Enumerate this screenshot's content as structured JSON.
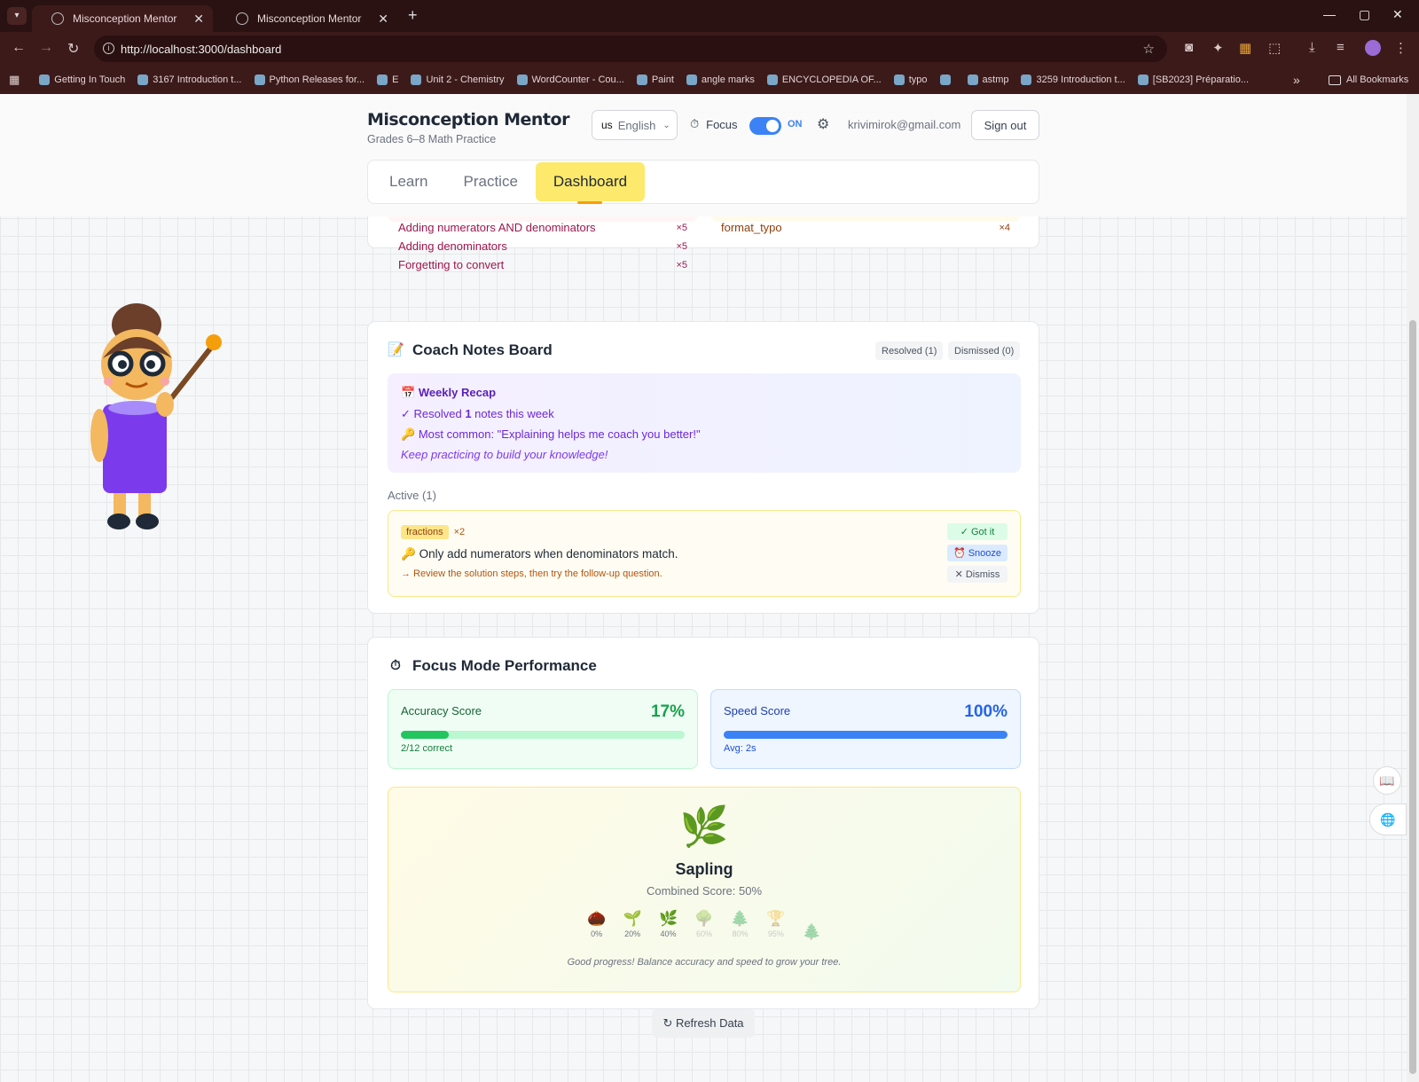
{
  "browser": {
    "tabs": [
      {
        "title": "Misconception Mentor",
        "active": true
      },
      {
        "title": "Misconception Mentor",
        "active": false
      }
    ],
    "url": "http://localhost:3000/dashboard",
    "bookmarks": [
      "Getting In Touch",
      "3167 Introduction t...",
      "Python Releases for...",
      "E",
      "Unit 2 - Chemistry",
      "WordCounter - Cou...",
      "Paint",
      "angle marks",
      "ENCYCLOPEDIA OF...",
      "typo",
      "",
      "astmp",
      "3259 Introduction t...",
      "[SB2023] Préparatio..."
    ],
    "all_bookmarks": "All Bookmarks",
    "more": "»"
  },
  "header": {
    "title": "Misconception Mentor",
    "subtitle": "Grades 6–8 Math Practice",
    "lang_code": "us",
    "lang_label": "English",
    "focus_label": "Focus",
    "focus_state": "ON",
    "email": "krivimirok@gmail.com",
    "signout": "Sign out"
  },
  "nav": {
    "tabs": [
      "Learn",
      "Practice",
      "Dashboard"
    ],
    "active": "Dashboard"
  },
  "misconceptions": {
    "left": [
      {
        "label": "Adding numerators AND denominators",
        "count": "×5"
      },
      {
        "label": "Adding denominators",
        "count": "×5"
      },
      {
        "label": "Forgetting to convert",
        "count": "×5"
      }
    ],
    "right": [
      {
        "label": "format_typo",
        "count": "×4"
      }
    ]
  },
  "coach": {
    "title": "Coach Notes Board",
    "resolved": "Resolved (1)",
    "dismissed": "Dismissed (0)",
    "recap_title": "Weekly Recap",
    "recap_resolved_pre": "✓ Resolved ",
    "recap_resolved_num": "1",
    "recap_resolved_post": " notes this week",
    "recap_common": "Most common: \"Explaining helps me coach you better!\"",
    "recap_keep": "Keep practicing to build your knowledge!",
    "active_label": "Active (1)",
    "note": {
      "tag": "fractions",
      "count": "×2",
      "text": "Only add numerators when denominators match.",
      "hint": "→ Review the solution steps, then try the follow-up question.",
      "got": "✓ Got it",
      "snooze": "Snooze",
      "dismiss": "Dismiss"
    }
  },
  "focus": {
    "title": "Focus Mode Performance",
    "accuracy_label": "Accuracy Score",
    "accuracy_value": "17%",
    "accuracy_fraction": 0.17,
    "accuracy_sub": "2/12 correct",
    "speed_label": "Speed Score",
    "speed_value": "100%",
    "speed_fraction": 1.0,
    "speed_sub": "Avg: 2s",
    "tree_stage": "Sapling",
    "combined": "Combined Score: 50%",
    "stages": [
      "0%",
      "20%",
      "40%",
      "60%",
      "80%",
      "95%"
    ],
    "message": "Good progress! Balance accuracy and speed to grow your tree."
  },
  "refresh": "↻ Refresh Data",
  "colors": {
    "accent_yellow": "#fde96b",
    "accent_blue": "#3b82f6",
    "accuracy_green": "#22c55e"
  }
}
